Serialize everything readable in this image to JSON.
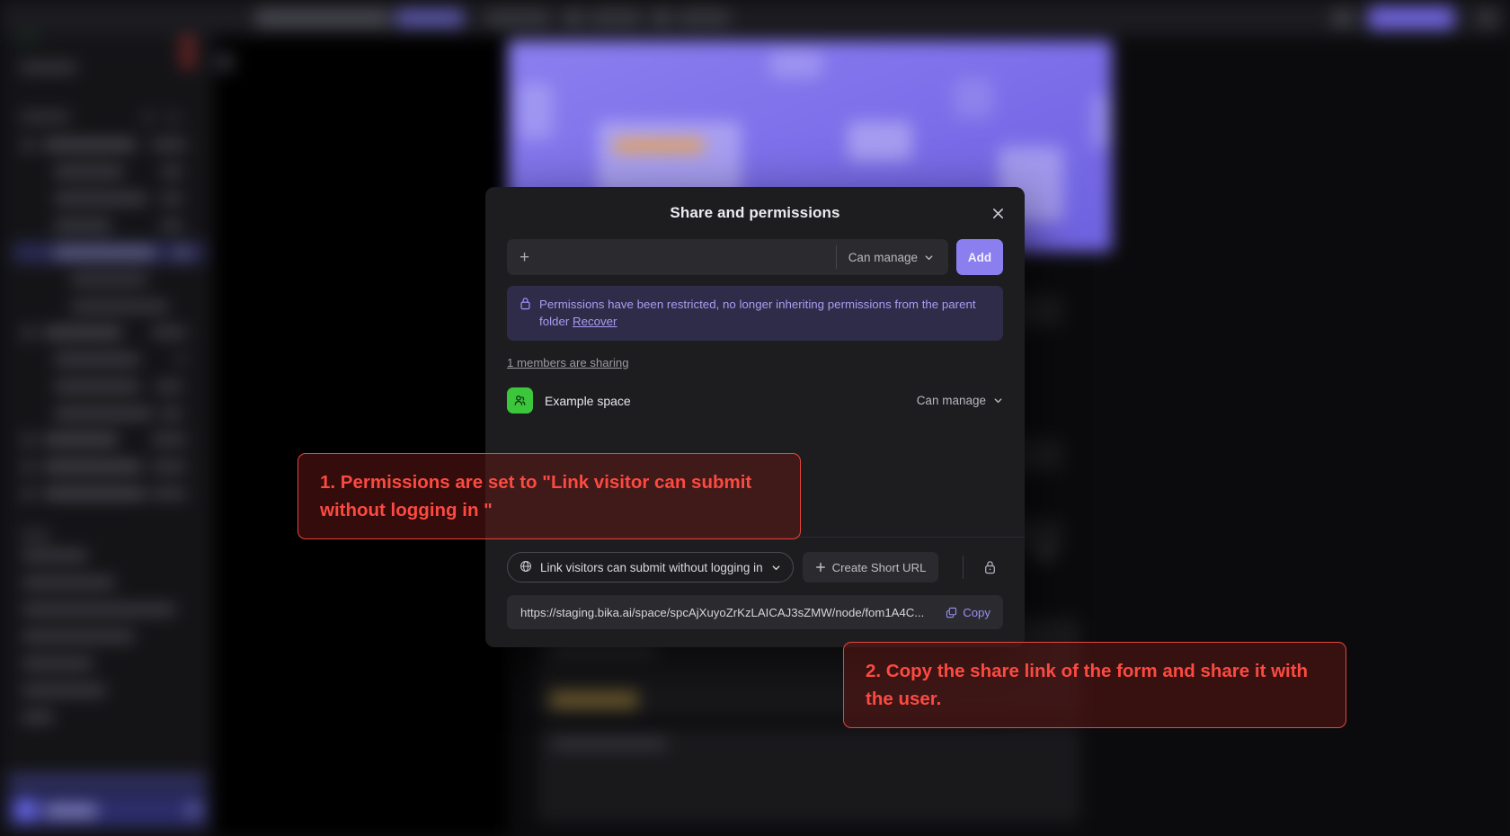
{
  "modal": {
    "title": "Share and permissions",
    "close_icon": "close-icon",
    "invite": {
      "plus_icon": "plus-icon",
      "placeholder": "",
      "value": "",
      "permission_label": "Can manage",
      "chevron_icon": "chevron-down-icon",
      "add_label": "Add"
    },
    "notice": {
      "lock_icon": "lock-icon",
      "text": "Permissions have been restricted, no longer inheriting permissions from the parent folder ",
      "link_label": "Recover"
    },
    "members_count_label": "1 members are sharing",
    "members": [
      {
        "avatar_icon": "group-avatar-icon",
        "avatar_color": "#3cc63c",
        "name": "Example space",
        "permission_label": "Can manage",
        "chevron_icon": "chevron-down-icon"
      }
    ],
    "footer": {
      "globe_icon": "globe-icon",
      "visibility_label": "Link visitors can submit without logging in",
      "visibility_chevron_icon": "chevron-down-icon",
      "short_url_plus_icon": "plus-icon",
      "short_url_label": "Create Short URL",
      "lock_icon": "lock-icon",
      "share_url": "https://staging.bika.ai/space/spcAjXuyoZrKzLAICAJ3sZMW/node/fom1A4C...",
      "copy_icon": "copy-icon",
      "copy_label": "Copy"
    }
  },
  "annotations": [
    {
      "text": "1. Permissions are set to \"Link visitor can submit without logging in \""
    },
    {
      "text": "2. Copy the share link of the form and share it with the user."
    }
  ],
  "colors": {
    "accent_purple": "#8b7ff0",
    "notice_purple": "#a79df0",
    "avatar_green": "#3cc63c",
    "annotation_red": "#fc4a41",
    "modal_bg": "#1d1d20"
  }
}
